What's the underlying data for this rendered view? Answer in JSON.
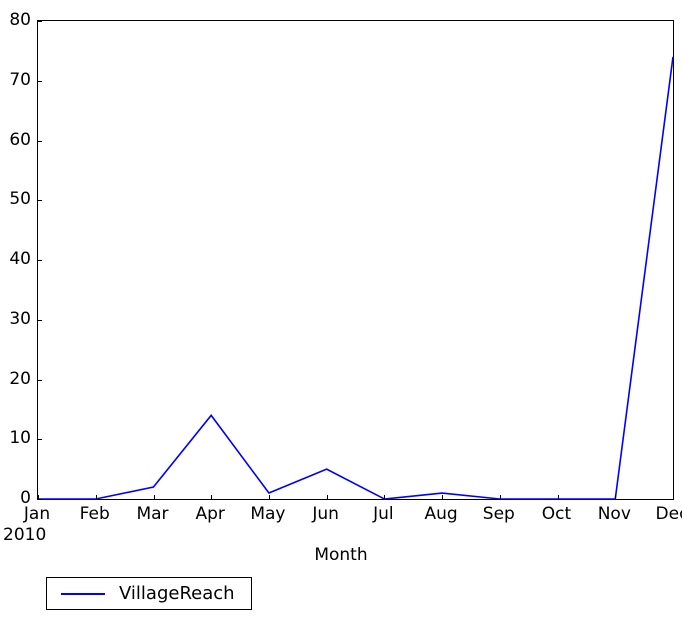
{
  "chart_data": {
    "type": "line",
    "title": "",
    "xlabel": "Month",
    "ylabel": "",
    "x_sublabel": "2010",
    "categories": [
      "Jan",
      "Feb",
      "Mar",
      "Apr",
      "May",
      "Jun",
      "Jul",
      "Aug",
      "Sep",
      "Oct",
      "Nov",
      "Dec"
    ],
    "ylim": [
      0,
      80
    ],
    "yticks": [
      0,
      10,
      20,
      30,
      40,
      50,
      60,
      70,
      80
    ],
    "ytick_labels": [
      "0",
      "10",
      "20",
      "30",
      "40",
      "50",
      "60",
      "70",
      "80"
    ],
    "grid": false,
    "legend_position": "below-left",
    "series": [
      {
        "name": "VillageReach",
        "color": "#0000ff",
        "values": [
          0,
          0,
          2,
          14,
          1,
          5,
          0,
          1,
          0,
          0,
          0,
          74
        ]
      }
    ]
  },
  "legend": {
    "entries": [
      {
        "label": "VillageReach",
        "color": "#0000ff"
      }
    ]
  },
  "axis": {
    "xlabel": "Month",
    "x_sublabel": "2010"
  }
}
